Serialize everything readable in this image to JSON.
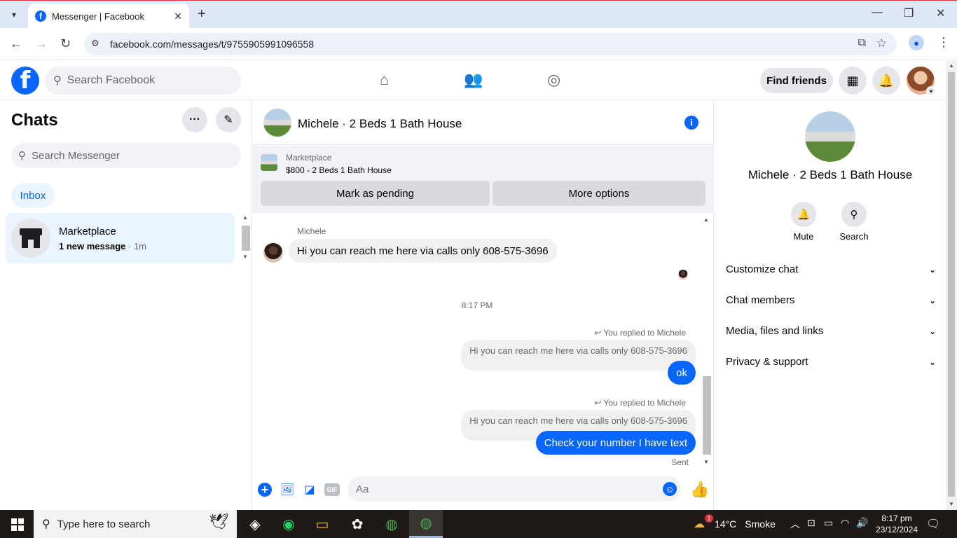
{
  "browser": {
    "tab_title": "Messenger | Facebook",
    "url": "facebook.com/messages/t/9755905991096558",
    "new_tab": "+",
    "minimize": "—",
    "restore": "❐",
    "close": "✕"
  },
  "facebook": {
    "search_placeholder": "Search Facebook",
    "find_friends": "Find friends"
  },
  "left": {
    "title": "Chats",
    "search_placeholder": "Search Messenger",
    "inbox_label": "Inbox",
    "conversations": [
      {
        "name": "Marketplace",
        "preview": "1 new message",
        "sep": " · ",
        "time": "1m"
      }
    ]
  },
  "chat": {
    "title": "Michele · 2 Beds 1 Bath House",
    "marketplace": {
      "label": "Marketplace",
      "listing": "$800 - 2 Beds 1 Bath House",
      "mark_pending": "Mark as pending",
      "more_options": "More options"
    },
    "messages": {
      "sender": "Michele",
      "incoming": "Hi you can reach me here via calls only 608-575-3696",
      "time_separator": "8:17 PM",
      "replies": [
        {
          "replied_label": "You replied to Michele",
          "quoted": "Hi you can reach me here via calls only 608-575-3696",
          "text": "ok"
        },
        {
          "replied_label": "You replied to Michele",
          "quoted": "Hi you can reach me here via calls only 608-575-3696",
          "text": "Check your number I have text"
        }
      ],
      "status": "Sent"
    },
    "composer": {
      "placeholder": "Aa",
      "gif_label": "GIF"
    }
  },
  "right": {
    "name": "Michele · 2 Beds 1 Bath House",
    "actions": [
      {
        "label": "Mute"
      },
      {
        "label": "Search"
      }
    ],
    "sections": [
      "Customize chat",
      "Chat members",
      "Media, files and links",
      "Privacy & support"
    ]
  },
  "taskbar": {
    "search_placeholder": "Type here to search",
    "temperature": "14°C",
    "weather": "Smoke",
    "weather_badge": "1",
    "time": "8:17 pm",
    "date": "23/12/2024"
  },
  "colors": {
    "accent": "#0866ff",
    "bubble_in": "#f0f0f0",
    "panel_bg": "#f0f2f5"
  }
}
